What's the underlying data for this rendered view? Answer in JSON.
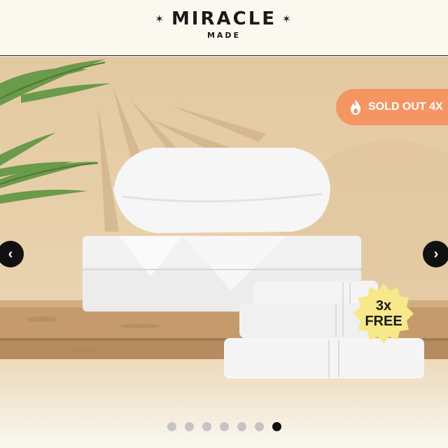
{
  "brand": {
    "name": "MIRACLE",
    "tagline": "MADE",
    "star_left": "✶",
    "star_right": "✶"
  },
  "hero": {
    "badge": {
      "icon": "flame-icon",
      "text": "SOLD OUT 4X",
      "color": "#f59563"
    },
    "free_badge": {
      "line1": "3x",
      "line2": "FREE",
      "color": "#f7e88a"
    },
    "nav": {
      "prev_symbol": "‹",
      "next_symbol": "›"
    },
    "carousel": {
      "total_slides": 7,
      "active_slide": 7
    }
  }
}
